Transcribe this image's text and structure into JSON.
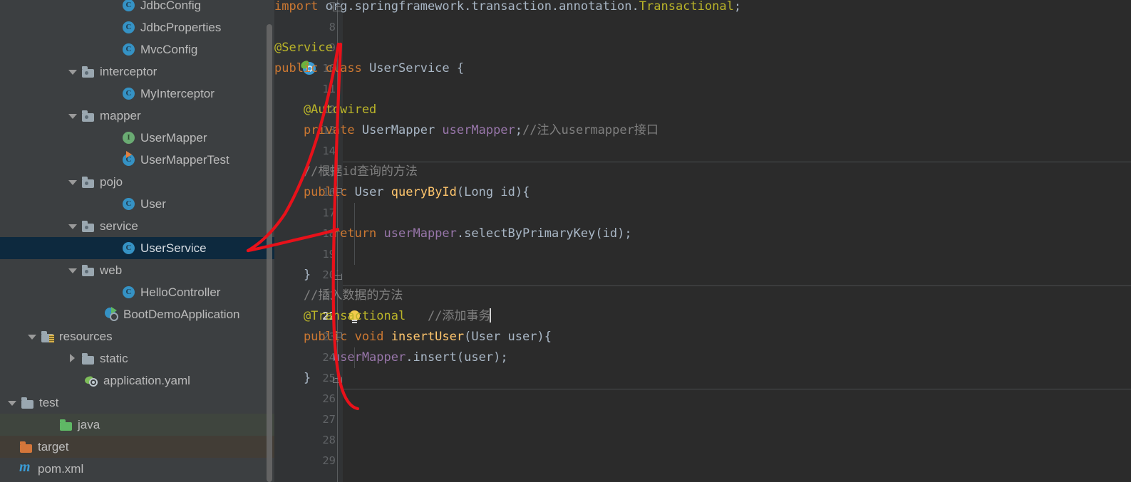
{
  "sidebar": {
    "scrollbar": "vertical-scrollbar",
    "items": [
      {
        "label": "JdbcConfig",
        "icon": "class-icon",
        "indent": 152,
        "arrow": "none",
        "tint": "none"
      },
      {
        "label": "JdbcProperties",
        "icon": "class-icon",
        "indent": 152,
        "arrow": "none",
        "tint": "none"
      },
      {
        "label": "MvcConfig",
        "icon": "class-icon",
        "indent": 152,
        "arrow": "none",
        "tint": "none"
      },
      {
        "label": "interceptor",
        "icon": "package-folder-icon",
        "indent": 95,
        "arrow": "down",
        "tint": "none"
      },
      {
        "label": "MyInterceptor",
        "icon": "class-icon",
        "indent": 152,
        "arrow": "none",
        "tint": "none"
      },
      {
        "label": "mapper",
        "icon": "package-folder-icon",
        "indent": 95,
        "arrow": "down",
        "tint": "none"
      },
      {
        "label": "UserMapper",
        "icon": "interface-icon",
        "indent": 152,
        "arrow": "none",
        "tint": "none"
      },
      {
        "label": "UserMapperTest",
        "icon": "class-runnable-icon",
        "indent": 152,
        "arrow": "none",
        "tint": "none"
      },
      {
        "label": "pojo",
        "icon": "package-folder-icon",
        "indent": 95,
        "arrow": "down",
        "tint": "none"
      },
      {
        "label": "User",
        "icon": "class-icon",
        "indent": 152,
        "arrow": "none",
        "tint": "none"
      },
      {
        "label": "service",
        "icon": "package-folder-icon",
        "indent": 95,
        "arrow": "down",
        "tint": "none"
      },
      {
        "label": "UserService",
        "icon": "class-icon",
        "indent": 152,
        "arrow": "none",
        "tint": "selected"
      },
      {
        "label": "web",
        "icon": "package-folder-icon",
        "indent": 95,
        "arrow": "down",
        "tint": "none"
      },
      {
        "label": "HelloController",
        "icon": "class-icon",
        "indent": 152,
        "arrow": "none",
        "tint": "none"
      },
      {
        "label": "BootDemoApplication",
        "icon": "spring-boot-icon",
        "indent": 128,
        "arrow": "none",
        "tint": "none"
      },
      {
        "label": "resources",
        "icon": "resources-folder-icon",
        "indent": 38,
        "arrow": "down",
        "tint": "none"
      },
      {
        "label": "static",
        "icon": "folder-icon",
        "indent": 95,
        "arrow": "right",
        "tint": "none"
      },
      {
        "label": "application.yaml",
        "icon": "yaml-icon",
        "indent": 100,
        "arrow": "none",
        "tint": "none"
      },
      {
        "label": "test",
        "icon": "folder-icon",
        "indent": 10,
        "arrow": "down",
        "tint": "none"
      },
      {
        "label": "java",
        "icon": "source-folder-green-icon",
        "indent": 64,
        "arrow": "none",
        "tint": "test"
      },
      {
        "label": "target",
        "icon": "excluded-folder-icon",
        "indent": 8,
        "arrow": "none",
        "tint": "target"
      },
      {
        "label": "pom.xml",
        "icon": "maven-icon",
        "indent": 8,
        "arrow": "none",
        "tint": "none"
      }
    ]
  },
  "editor": {
    "current_line": 22,
    "first_line": 7,
    "last_line": 29,
    "line_numbers": [
      7,
      8,
      9,
      10,
      11,
      12,
      13,
      14,
      15,
      16,
      17,
      18,
      19,
      20,
      21,
      22,
      23,
      24,
      25,
      26,
      27,
      28,
      29
    ],
    "gutter_icons": [
      {
        "name": "spring-bean-icon",
        "line": 10
      },
      {
        "name": "intention-bulb-icon",
        "line": 22
      }
    ],
    "lines": [
      {
        "n": 7,
        "tokens": [
          {
            "t": "import ",
            "c": "k"
          },
          {
            "t": "org.springframework.transaction.annotation.",
            "c": "pl"
          },
          {
            "t": "Transactional",
            "c": "an"
          },
          {
            "t": ";",
            "c": "pl"
          }
        ]
      },
      {
        "n": 8,
        "tokens": []
      },
      {
        "n": 9,
        "tokens": [
          {
            "t": "@Service",
            "c": "an"
          }
        ]
      },
      {
        "n": 10,
        "tokens": [
          {
            "t": "public class ",
            "c": "k"
          },
          {
            "t": "UserService ",
            "c": "ty"
          },
          {
            "t": "{",
            "c": "br"
          }
        ]
      },
      {
        "n": 11,
        "tokens": []
      },
      {
        "n": 12,
        "tokens": [
          {
            "t": "    @Autowired",
            "c": "an"
          }
        ]
      },
      {
        "n": 13,
        "tokens": [
          {
            "t": "    private ",
            "c": "k"
          },
          {
            "t": "UserMapper ",
            "c": "ty"
          },
          {
            "t": "userMapper",
            "c": "fl"
          },
          {
            "t": ";",
            "c": "pl"
          },
          {
            "t": "//注入usermapper接口",
            "c": "cm"
          }
        ]
      },
      {
        "n": 14,
        "tokens": []
      },
      {
        "n": 15,
        "tokens": [
          {
            "t": "    //根据id查询的方法",
            "c": "cm"
          }
        ]
      },
      {
        "n": 16,
        "tokens": [
          {
            "t": "    public ",
            "c": "k"
          },
          {
            "t": "User ",
            "c": "ty"
          },
          {
            "t": "queryById",
            "c": "mt"
          },
          {
            "t": "(",
            "c": "br"
          },
          {
            "t": "Long id",
            "c": "ty"
          },
          {
            "t": ")",
            "c": "br"
          },
          {
            "t": "{",
            "c": "br"
          }
        ]
      },
      {
        "n": 17,
        "tokens": []
      },
      {
        "n": 18,
        "tokens": [
          {
            "t": "        return ",
            "c": "k"
          },
          {
            "t": "userMapper",
            "c": "fl"
          },
          {
            "t": ".",
            "c": "pl"
          },
          {
            "t": "selectByPrimaryKey",
            "c": "ty"
          },
          {
            "t": "(",
            "c": "br"
          },
          {
            "t": "id",
            "c": "ty"
          },
          {
            "t": ");",
            "c": "br"
          }
        ]
      },
      {
        "n": 19,
        "tokens": []
      },
      {
        "n": 20,
        "tokens": [
          {
            "t": "    }",
            "c": "br"
          }
        ]
      },
      {
        "n": 21,
        "tokens": [
          {
            "t": "    //插入数据的方法",
            "c": "cm"
          }
        ]
      },
      {
        "n": 22,
        "tokens": [
          {
            "t": "    @Transactional",
            "c": "an"
          },
          {
            "t": "   //添加事务",
            "c": "cm"
          }
        ],
        "caret": true
      },
      {
        "n": 23,
        "tokens": [
          {
            "t": "    public void ",
            "c": "k"
          },
          {
            "t": "insertUser",
            "c": "mt"
          },
          {
            "t": "(",
            "c": "br"
          },
          {
            "t": "User user",
            "c": "ty"
          },
          {
            "t": ")",
            "c": "br"
          },
          {
            "t": "{",
            "c": "br"
          }
        ]
      },
      {
        "n": 24,
        "tokens": [
          {
            "t": "        userMapper",
            "c": "fl"
          },
          {
            "t": ".",
            "c": "pl"
          },
          {
            "t": "insert",
            "c": "ty"
          },
          {
            "t": "(",
            "c": "br"
          },
          {
            "t": "user",
            "c": "ty"
          },
          {
            "t": ");",
            "c": "br"
          }
        ]
      },
      {
        "n": 25,
        "tokens": [
          {
            "t": "    }",
            "c": "br"
          }
        ]
      },
      {
        "n": 26,
        "tokens": []
      },
      {
        "n": 27,
        "tokens": []
      },
      {
        "n": 28,
        "tokens": []
      },
      {
        "n": 29,
        "tokens": []
      }
    ],
    "fold_markers": [
      {
        "line": 7,
        "type": "end"
      },
      {
        "line": 16,
        "type": "start"
      },
      {
        "line": 20,
        "type": "end"
      },
      {
        "line": 23,
        "type": "start"
      },
      {
        "line": 25,
        "type": "end"
      }
    ]
  },
  "annotation": {
    "name": "red-ink-annotation",
    "color": "#e8111a",
    "description": "hand-drawn red curve linking UserService tree node to the service class body"
  },
  "colors": {
    "sidebar_bg": "#3c3f41",
    "editor_bg": "#2b2b2b",
    "gutter_bg": "#313335",
    "selection_bg": "#0d293e",
    "keyword": "#cc7832",
    "annotation_token": "#bbb529",
    "method": "#ffc66d",
    "field": "#9876aa",
    "comment": "#808080",
    "identifier": "#a9b7c6",
    "line_number": "#606366",
    "accent_red": "#e8111a"
  }
}
